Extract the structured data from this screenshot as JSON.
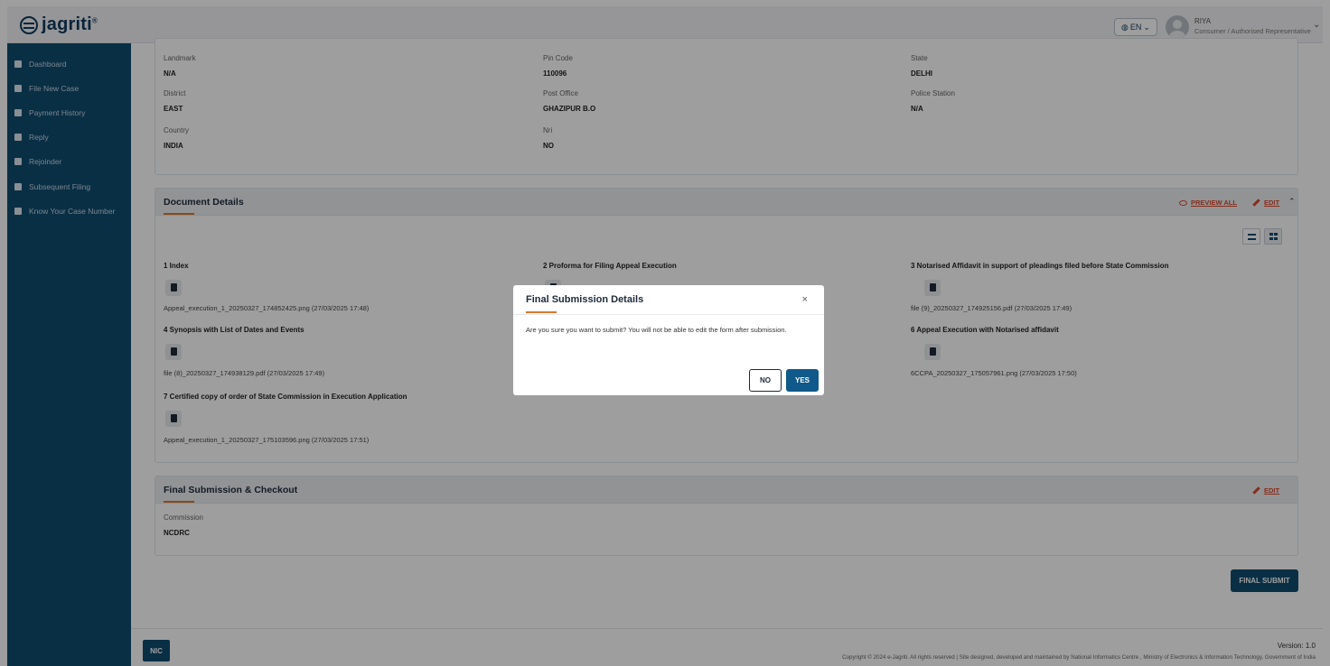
{
  "header": {
    "logo_text": "jagriti",
    "logo_sup": "®",
    "language": "EN",
    "user_name": "RIYA",
    "user_role": "Consumer / Authorised Representative"
  },
  "sidebar": {
    "items": [
      {
        "label": "Dashboard",
        "icon": "dashboard-icon"
      },
      {
        "label": "File New Case",
        "icon": "file-icon"
      },
      {
        "label": "Payment History",
        "icon": "payment-icon"
      },
      {
        "label": "Reply",
        "icon": "edit-icon"
      },
      {
        "label": "Rejoinder",
        "icon": "file-icon"
      },
      {
        "label": "Subsequent Filing",
        "icon": "file-icon"
      },
      {
        "label": "Know Your Case Number",
        "icon": "edit-icon"
      }
    ]
  },
  "address": {
    "landmark_label": "Landmark",
    "landmark_value": "N/A",
    "pincode_label": "Pin Code",
    "pincode_value": "110096",
    "state_label": "State",
    "state_value": "DELHI",
    "district_label": "District",
    "district_value": "EAST",
    "postoffice_label": "Post Office",
    "postoffice_value": "GHAZIPUR B.O",
    "police_label": "Police Station",
    "police_value": "N/A",
    "country_label": "Country",
    "country_value": "INDIA",
    "nri_label": "Nri",
    "nri_value": "NO"
  },
  "documents": {
    "title": "Document Details",
    "preview_all": "PREVIEW ALL",
    "edit": "EDIT",
    "items": [
      {
        "title": "1 Index",
        "file": "Appeal_execution_1_20250327_174852425.png (27/03/2025 17:48)"
      },
      {
        "title": "2 Proforma for Filing Appeal Execution",
        "file": ""
      },
      {
        "title": "3 Notarised Affidavit in support of pleadings filed before State Commission",
        "file": "file (9)_20250327_174925156.pdf (27/03/2025 17:49)"
      },
      {
        "title": "4 Synopsis with List of Dates and Events",
        "file": "file (8)_20250327_174938129.pdf (27/03/2025 17:49)"
      },
      {
        "title": "6 Appeal Execution with Notarised affidavit",
        "file": "6CCPA_20250327_175057961.png (27/03/2025 17:50)"
      },
      {
        "title": "7 Certified copy of order of State Commission in Execution Application",
        "file": "Appeal_execution_1_20250327_175103596.png (27/03/2025 17:51)"
      }
    ]
  },
  "final_section": {
    "title": "Final Submission & Checkout",
    "edit": "EDIT",
    "commission_label": "Commission",
    "commission_value": "NCDRC"
  },
  "final_submit_label": "FINAL SUBMIT",
  "footer": {
    "nic": "NIC",
    "version": "Version: 1.0",
    "copyright": "Copyright © 2024 e-Jagriti. All rights reserved | Site designed, developed and maintained by National Informatics Centre , Ministry of Electronics & Information Technology, Government of India"
  },
  "modal": {
    "title": "Final Submission Details",
    "close": "×",
    "body": "Are you sure you want to submit? You will not be able to edit the form after submission.",
    "no_label": "NO",
    "yes_label": "YES"
  },
  "colors": {
    "sidebar_bg": "#0f4c70",
    "accent_orange": "#d9782d",
    "link_red": "#d9482d",
    "primary_button": "#0f5a8a"
  }
}
